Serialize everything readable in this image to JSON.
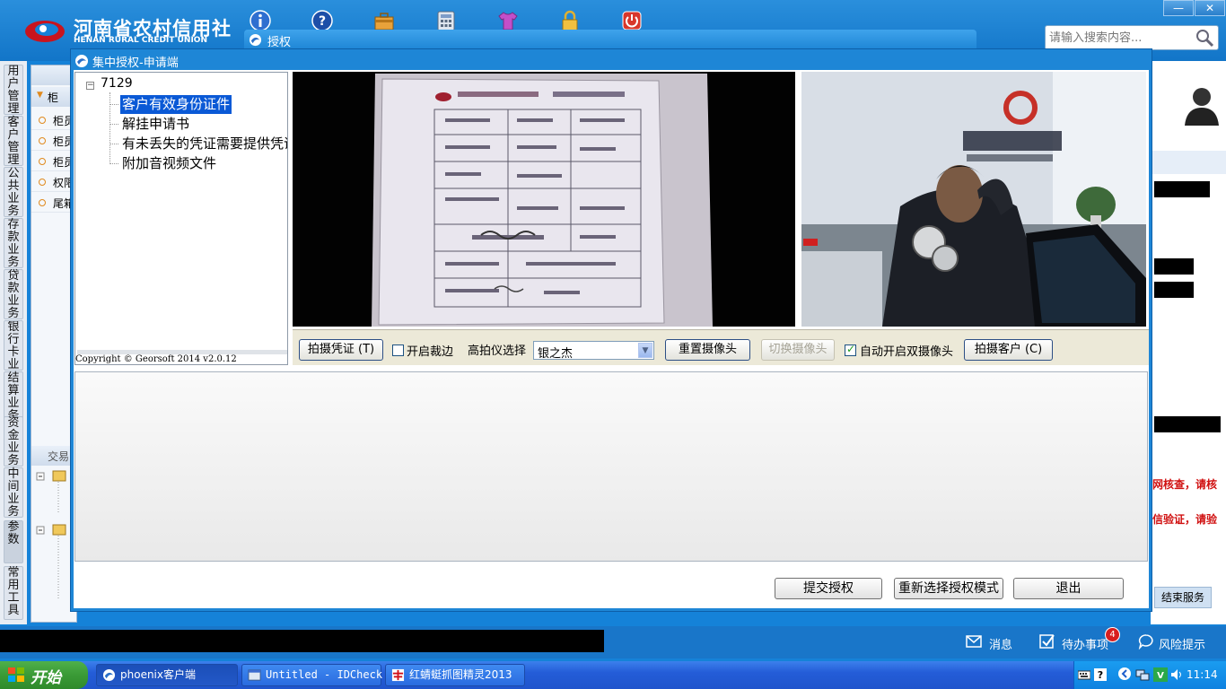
{
  "header": {
    "logo_cn": "河南省农村信用社",
    "logo_en": "HENAN RURAL CREDIT UNION",
    "toolbar_icons": [
      "info-icon",
      "help-icon",
      "toolbox-icon",
      "calculator-icon",
      "shirt-icon",
      "lock-icon",
      "power-icon"
    ],
    "search_placeholder": "请输入搜索内容...",
    "window_minimize": "—",
    "window_close": "✕"
  },
  "background_tab": {
    "label": "授权"
  },
  "left_nav": {
    "columns": [
      "用户管理",
      "客户管理",
      "公共业务",
      "存款业务",
      "贷款业务",
      "银行卡业务",
      "结算业务",
      "资金业务",
      "中间业务",
      "参数",
      "常用工具"
    ],
    "panel_head": "柜",
    "panel_items": [
      "柜员",
      "柜员",
      "柜员",
      "权限",
      "尾箱"
    ],
    "panel_head2": "交易"
  },
  "dialog": {
    "title": "集中授权-申请端",
    "tree": {
      "root": "7129",
      "nodes": [
        "客户有效身份证件",
        "解挂申请书",
        "有未丢失的凭证需要提供凭证",
        "附加音视频文件"
      ],
      "selected_index": 0,
      "copyright": "Copyright © Georsoft 2014 v2.0.12"
    },
    "camera_toolbar": {
      "capture_voucher": "拍摄凭证 (T)",
      "crop_label": "开启裁边",
      "crop_checked": false,
      "scanner_label": "高拍仪选择",
      "scanner_value": "银之杰",
      "reset_camera": "重置摄像头",
      "switch_camera": "切换摄像头",
      "dual_camera_label": "自动开启双摄像头",
      "dual_camera_checked": true,
      "capture_customer": "拍摄客户 (C)"
    },
    "buttons": {
      "submit": "提交授权",
      "reselect": "重新选择授权模式",
      "exit": "退出"
    }
  },
  "right_panel": {
    "red_text_1": "网核查，请核",
    "red_text_2": "信验证，请验",
    "end_service": "结束服务"
  },
  "status_bar": {
    "message": "消息",
    "todo": "待办事项",
    "todo_count": "4",
    "risk": "风险提示"
  },
  "taskbar": {
    "start": "开始",
    "tasks": [
      "phoenix客户端",
      "Untitled - IDCheck",
      "红蜻蜓抓图精灵2013"
    ],
    "clock": "11:14"
  },
  "colors": {
    "header_blue": "#1582d8",
    "selection_blue": "#0a59d6",
    "alert_red": "#d01010",
    "start_green": "#3a9a36"
  }
}
